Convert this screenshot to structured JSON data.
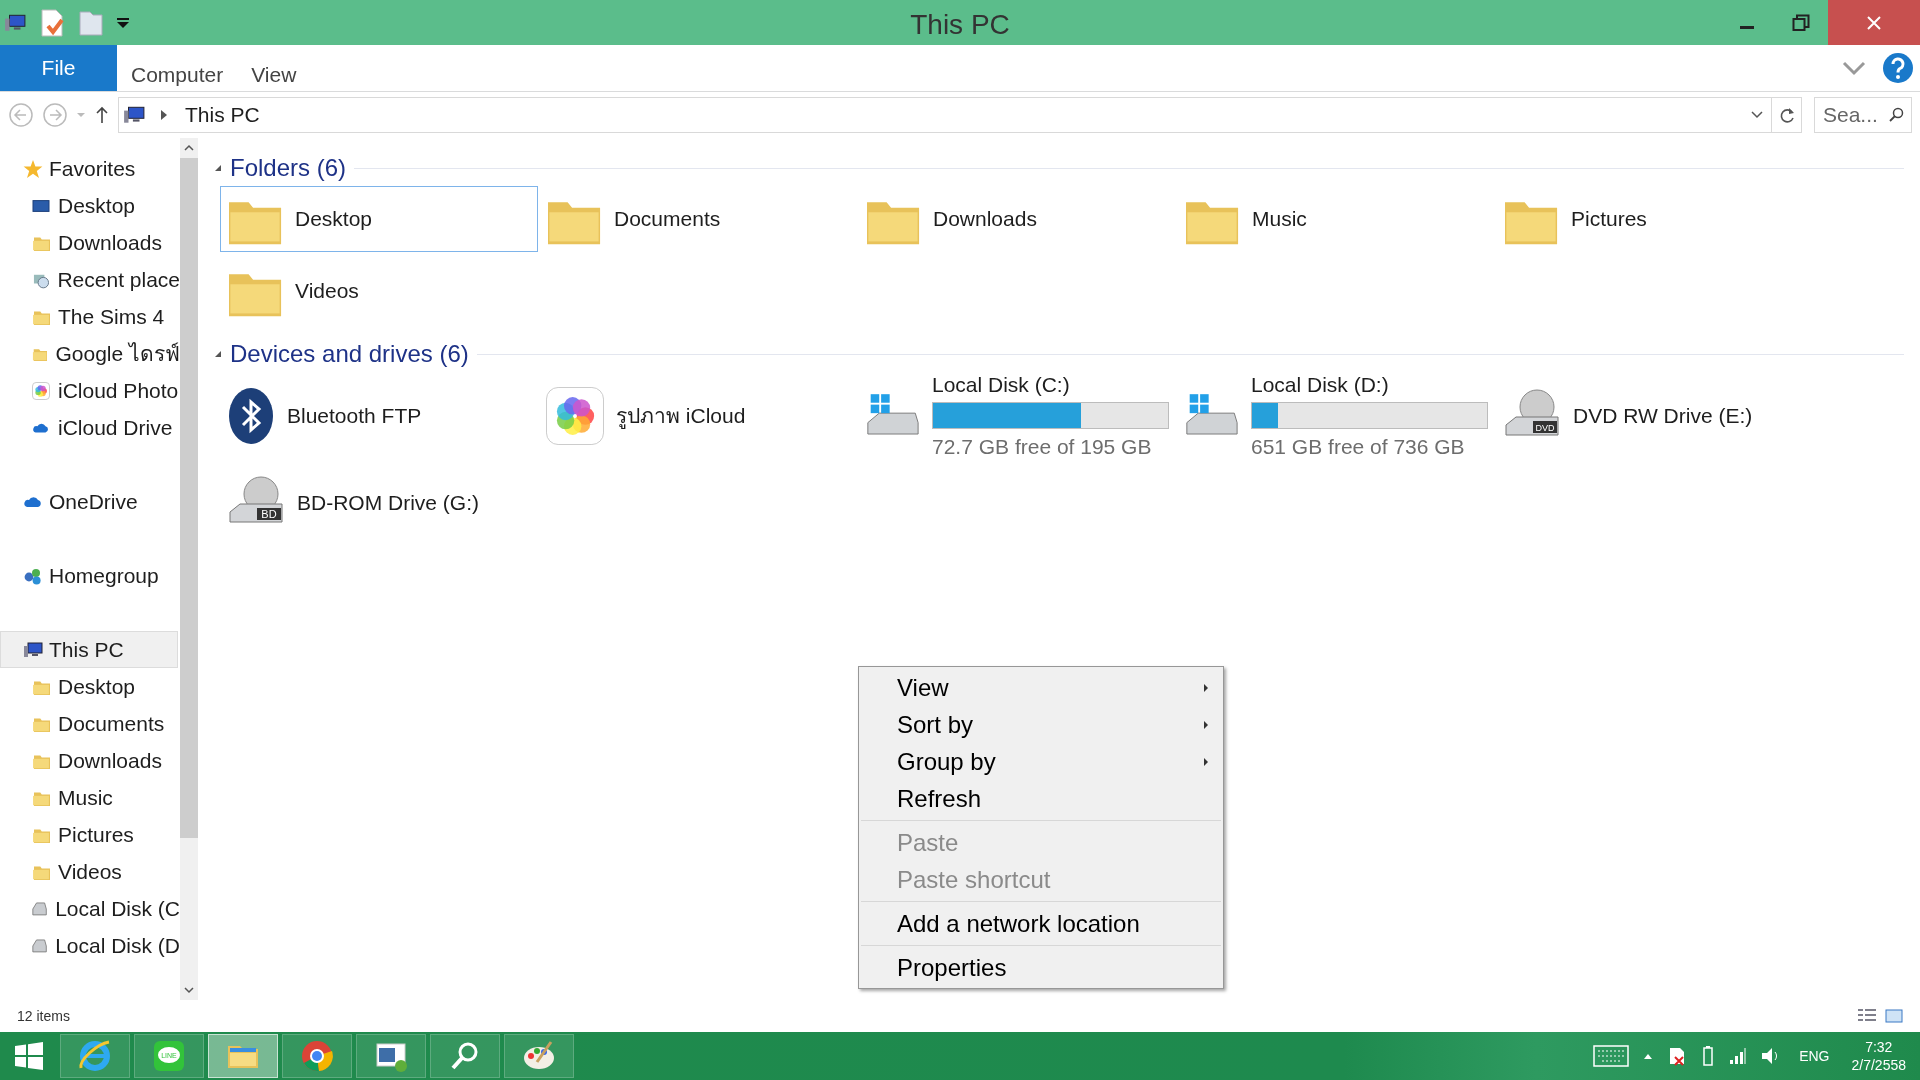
{
  "window": {
    "title": "This PC"
  },
  "ribbon_tabs": [
    {
      "label": "File",
      "selected": true
    },
    {
      "label": "Computer",
      "selected": false
    },
    {
      "label": "View",
      "selected": false
    }
  ],
  "address": {
    "path": "This PC",
    "search_placeholder": "Sea..."
  },
  "sidebar": {
    "groups": [
      {
        "label": "Favorites",
        "kind": "star",
        "selected": false,
        "children": [
          {
            "label": "Desktop",
            "kind": "desktop"
          },
          {
            "label": "Downloads",
            "kind": "folder"
          },
          {
            "label": "Recent place",
            "kind": "recent"
          },
          {
            "label": "The Sims 4",
            "kind": "folder"
          },
          {
            "label": "Google ไดรฟ์",
            "kind": "folder"
          },
          {
            "label": "iCloud Photo",
            "kind": "photos"
          },
          {
            "label": "iCloud Drive",
            "kind": "cloud"
          }
        ]
      },
      {
        "label": "OneDrive",
        "kind": "cloud",
        "selected": false
      },
      {
        "label": "Homegroup",
        "kind": "homegroup",
        "selected": false
      },
      {
        "label": "This PC",
        "kind": "pc",
        "selected": true,
        "children": [
          {
            "label": "Desktop",
            "kind": "folder"
          },
          {
            "label": "Documents",
            "kind": "folder"
          },
          {
            "label": "Downloads",
            "kind": "folder"
          },
          {
            "label": "Music",
            "kind": "folder"
          },
          {
            "label": "Pictures",
            "kind": "folder"
          },
          {
            "label": "Videos",
            "kind": "folder"
          },
          {
            "label": "Local Disk (C",
            "kind": "disk"
          },
          {
            "label": "Local Disk (D",
            "kind": "disk"
          }
        ]
      }
    ]
  },
  "sections": [
    {
      "title": "Folders (6)",
      "expanded": true,
      "items": [
        {
          "kind": "folder",
          "label": "Desktop",
          "selected": true
        },
        {
          "kind": "folder",
          "label": "Documents",
          "selected": false
        },
        {
          "kind": "folder",
          "label": "Downloads",
          "selected": false
        },
        {
          "kind": "folder",
          "label": "Music",
          "selected": false
        },
        {
          "kind": "folder",
          "label": "Pictures",
          "selected": false
        },
        {
          "kind": "folder",
          "label": "Videos",
          "selected": false
        }
      ]
    },
    {
      "title": "Devices and drives (6)",
      "expanded": true,
      "items": [
        {
          "kind": "bluetooth",
          "label": "Bluetooth FTP",
          "selected": false
        },
        {
          "kind": "photos",
          "label": "รูปภาพ iCloud",
          "selected": false
        },
        {
          "kind": "disk",
          "label": "Local Disk (C:)",
          "level": 0.63,
          "free": "72.7 GB free of 195 GB",
          "selected": false
        },
        {
          "kind": "disk",
          "label": "Local Disk (D:)",
          "level": 0.11,
          "free": "651 GB free of 736 GB",
          "selected": false
        },
        {
          "kind": "optical",
          "label": "DVD RW Drive (E:)",
          "badge": "DVD",
          "selected": false
        },
        {
          "kind": "optical",
          "label": "BD-ROM Drive (G:)",
          "badge": "BD",
          "selected": false
        }
      ]
    }
  ],
  "context_menu": [
    {
      "label": "View",
      "submenu": true,
      "disabled": false,
      "separator_after": false
    },
    {
      "label": "Sort by",
      "submenu": true,
      "disabled": false,
      "separator_after": false
    },
    {
      "label": "Group by",
      "submenu": true,
      "disabled": false,
      "separator_after": false
    },
    {
      "label": "Refresh",
      "submenu": false,
      "disabled": false,
      "separator_after": true
    },
    {
      "label": "Paste",
      "submenu": false,
      "disabled": true,
      "separator_after": false
    },
    {
      "label": "Paste shortcut",
      "submenu": false,
      "disabled": true,
      "separator_after": true
    },
    {
      "label": "Add a network location",
      "submenu": false,
      "disabled": false,
      "separator_after": true
    },
    {
      "label": "Properties",
      "submenu": false,
      "disabled": false,
      "separator_after": false
    }
  ],
  "status_bar": {
    "count": "12 items"
  },
  "taskbar": {
    "apps": [
      {
        "kind": "ie",
        "selected": false
      },
      {
        "kind": "line",
        "label": "LINE",
        "selected": false
      },
      {
        "kind": "explorer",
        "selected": true
      },
      {
        "kind": "chrome",
        "selected": false
      },
      {
        "kind": "window",
        "selected": false
      },
      {
        "kind": "search",
        "selected": false
      },
      {
        "kind": "paint",
        "selected": false
      }
    ],
    "language": "ENG",
    "time": "7:32",
    "date": "2/7/2558"
  }
}
